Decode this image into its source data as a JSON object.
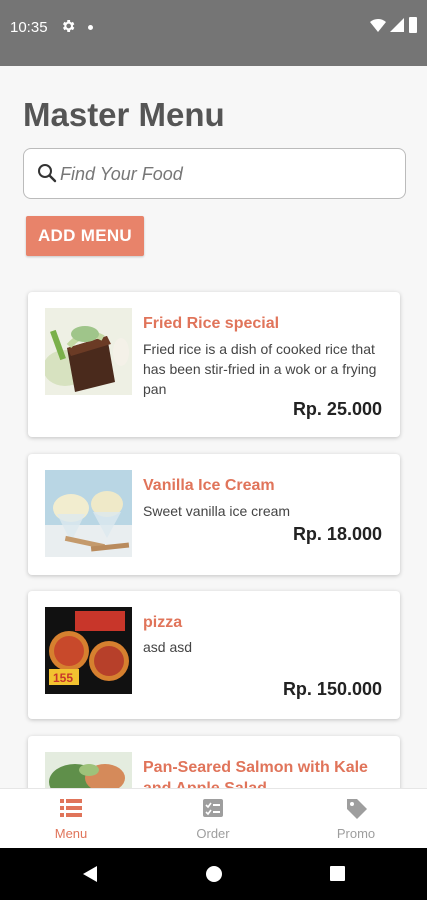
{
  "status_bar": {
    "time": "10:35",
    "icons": [
      "gear-icon",
      "notification-dot-icon",
      "wifi-icon",
      "signal-icon",
      "battery-icon"
    ]
  },
  "page": {
    "title": "Master Menu"
  },
  "search": {
    "placeholder": "Find Your Food",
    "value": ""
  },
  "add_button": {
    "label": "ADD MENU"
  },
  "menu_items": [
    {
      "name": "Fried Rice special",
      "description": "Fried rice is a dish of cooked rice that has been stir-fried in a wok or a frying pan",
      "price": "Rp. 25.000",
      "image": "chocolate-cake-image"
    },
    {
      "name": "Vanilla Ice Cream",
      "description": "Sweet vanilla ice cream",
      "price": "Rp. 18.000",
      "image": "ice-cream-image"
    },
    {
      "name": "pizza",
      "description": "asd asd",
      "price": "Rp. 150.000",
      "image": "pizza-image"
    },
    {
      "name": "Pan-Seared Salmon with Kale and Apple Salad",
      "description": "",
      "price": "",
      "image": "salmon-salad-image"
    }
  ],
  "bottom_nav": [
    {
      "label": "Menu",
      "icon": "menu-list-icon",
      "active": true
    },
    {
      "label": "Order",
      "icon": "order-checklist-icon",
      "active": false
    },
    {
      "label": "Promo",
      "icon": "promo-tag-icon",
      "active": false
    }
  ],
  "colors": {
    "accent": "#e0745a",
    "button": "#e8836a",
    "status_bar": "#757575",
    "inactive_nav": "#9e9e9e"
  }
}
